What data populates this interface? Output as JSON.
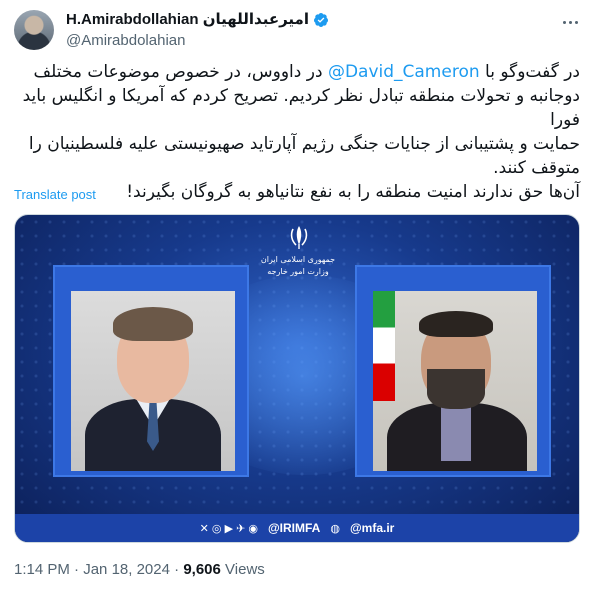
{
  "author": {
    "display_name": "H.Amirabdollahian امیرعبداللهیان",
    "handle": "@Amirabdolahian",
    "verified": true
  },
  "tweet": {
    "mention": "@David_Cameron",
    "line1_before": "در گفت‌وگو با ",
    "line1_after": " در داووس، در خصوص موضوعات مختلف",
    "line2": "دوجانبه و تحولات منطقه تبادل نظر کردیم. تصریح کردم که آمریکا و انگلیس باید فورا",
    "line3": "حمایت و پشتیبانی از جنایات جنگی رژیم آپارتاید صهیونیستی علیه فلسطینیان را",
    "line4": "متوقف کنند.",
    "line5": "آن‌ها حق ندارند امنیت منطقه را به نفع نتانیاهو به گروگان بگیرند!"
  },
  "translate_label": "Translate post",
  "media": {
    "ministry_line1": "جمهوری اسلامی ایران",
    "ministry_line2": "وزارت امور خارجه",
    "footer_social": "@IRIMFA",
    "footer_site": "@mfa.ir",
    "colors": {
      "background": "#173a8c",
      "frame": "#2a5fd0",
      "footer": "#1c43a8"
    }
  },
  "meta": {
    "time": "1:14 PM",
    "separator": "·",
    "date": "Jan 18, 2024",
    "views_count": "9,606",
    "views_label": "Views"
  },
  "colors": {
    "link": "#1d9bf0",
    "muted": "#536471",
    "text": "#0f1419"
  }
}
